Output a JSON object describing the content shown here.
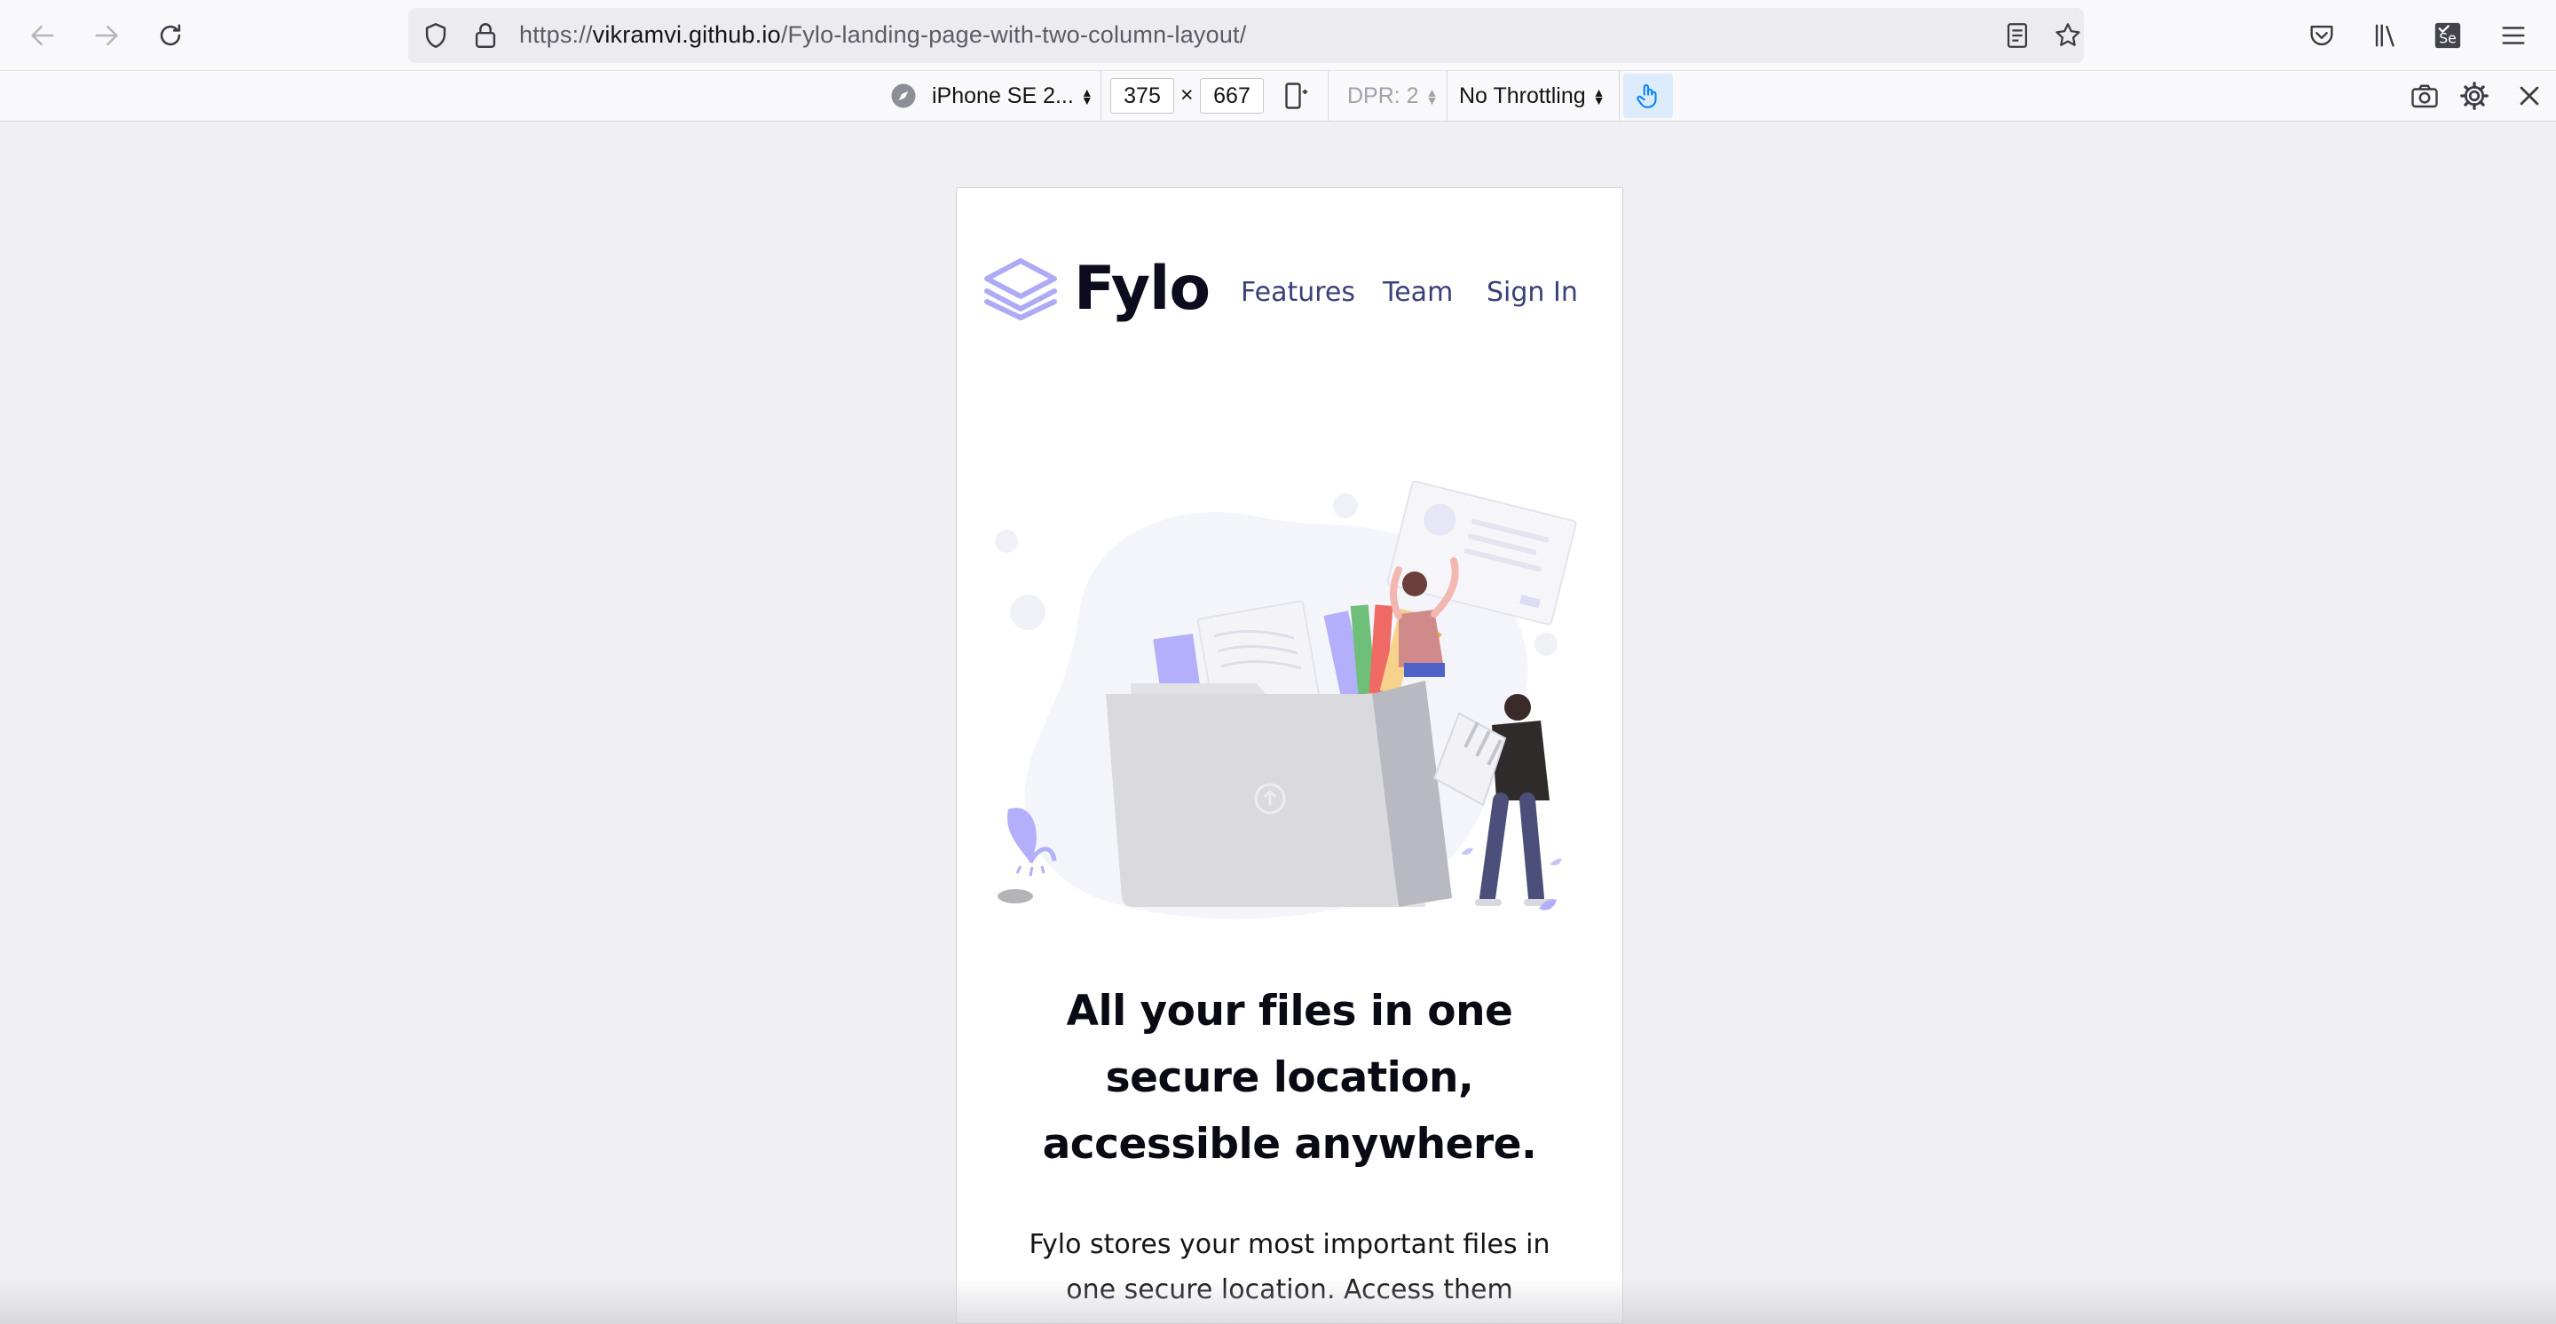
{
  "browser": {
    "url_prefix": "https://",
    "url_host": "vikramvi.github.io",
    "url_path": "/Fylo-landing-page-with-two-column-layout/",
    "icons": [
      "back-arrow-icon",
      "forward-arrow-icon",
      "reload-icon",
      "shield-icon",
      "lock-icon",
      "reader-view-icon",
      "bookmark-star-icon",
      "pocket-icon",
      "library-icon",
      "selenium-extension-icon",
      "hamburger-menu-icon"
    ]
  },
  "rdm": {
    "device": "iPhone SE 2...",
    "width": "375",
    "times": "×",
    "height": "667",
    "dpr": "DPR: 2",
    "throttling": "No Throttling"
  },
  "page": {
    "brand": "Fylo",
    "nav": {
      "features": "Features",
      "team": "Team",
      "sign_in": "Sign In"
    },
    "headline": "All your files in one secure location, accessible anywhere.",
    "lead": "Fylo stores your most important files in one secure location. Access them"
  },
  "colors": {
    "accent": "#3a4078",
    "logo": "#aeaaf5",
    "page_bg": "#f0f0f4",
    "touch_active": "#0a84ff"
  }
}
